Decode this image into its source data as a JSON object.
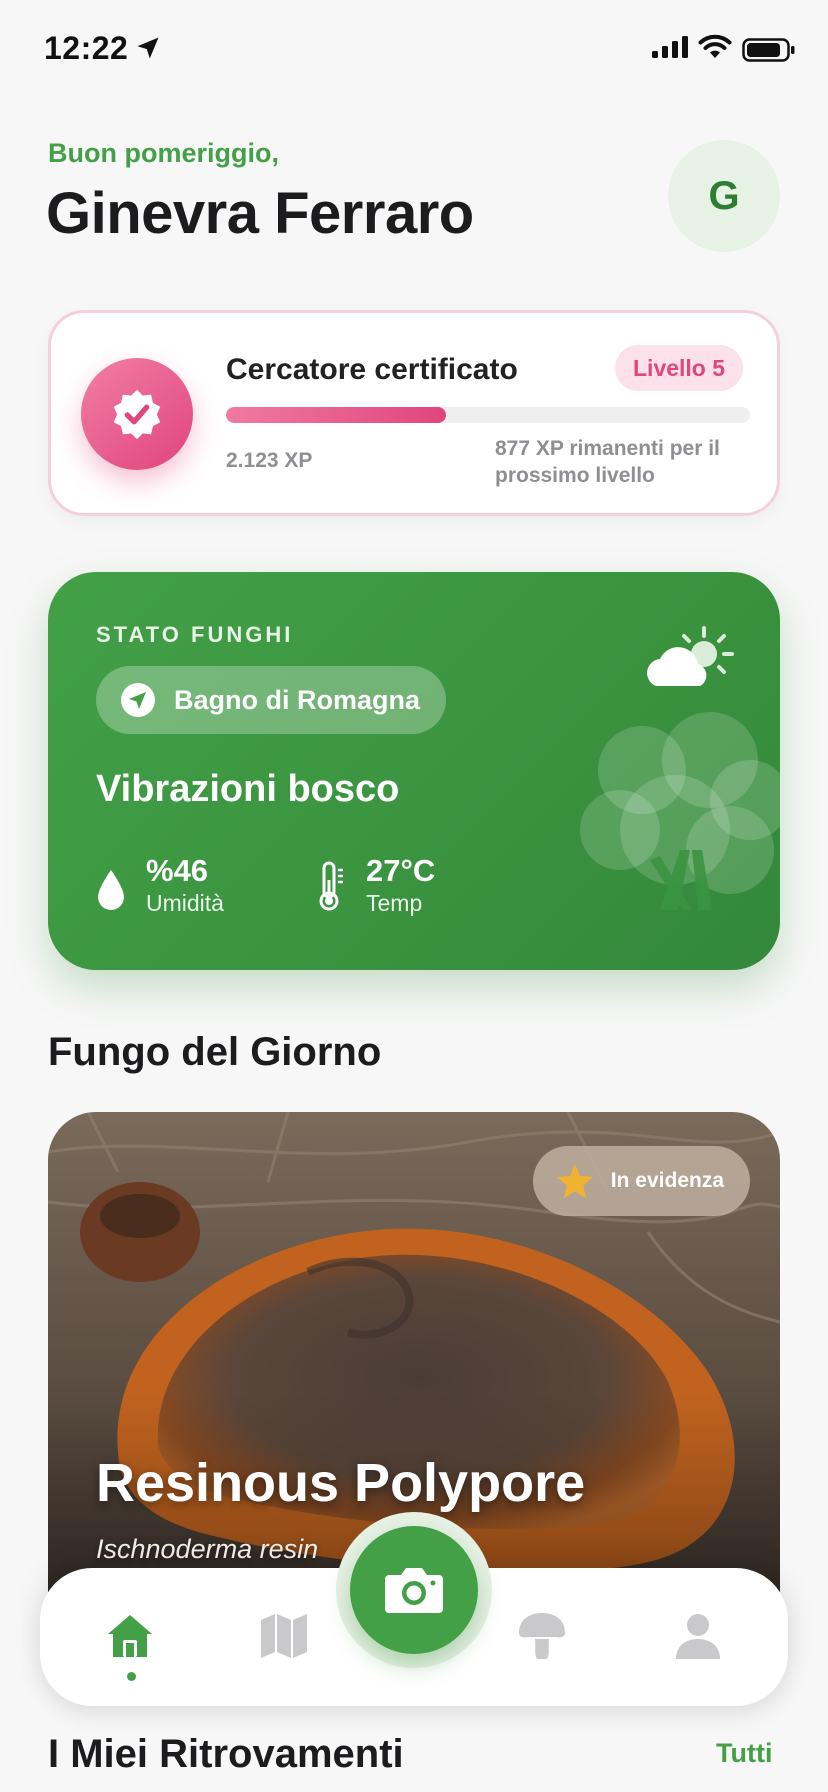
{
  "status_bar": {
    "time": "12:22"
  },
  "header": {
    "greeting": "Buon pomeriggio,",
    "user_name": "Ginevra Ferraro",
    "avatar_initial": "G"
  },
  "level_card": {
    "title": "Cercatore certificato",
    "level_label": "Livello 5",
    "xp_current": "2.123 XP",
    "xp_remaining": "877 XP rimanenti per il prossimo livello",
    "progress_fraction": 0.42
  },
  "mushroom_status": {
    "kicker": "STATO FUNGHI",
    "location": "Bagno di Romagna",
    "title": "Vibrazioni bosco",
    "humidity_value": "%46",
    "humidity_label": "Umidità",
    "temp_value": "27°C",
    "temp_label": "Temp"
  },
  "fungus_of_day": {
    "section_title": "Fungo del Giorno",
    "featured_label": "In evidenza",
    "name": "Resinous Polypore",
    "latin_name": "Ischnoderma resin"
  },
  "my_finds": {
    "title": "I Miei Ritrovamenti",
    "see_all": "Tutti"
  },
  "nav": {
    "items": [
      "home-icon",
      "map-icon",
      "camera-icon",
      "mushroom-icon",
      "profile-icon"
    ],
    "active": "home"
  },
  "colors": {
    "accent_green": "#43a047",
    "accent_pink": "#e0457c",
    "background": "#f7f7f7"
  }
}
